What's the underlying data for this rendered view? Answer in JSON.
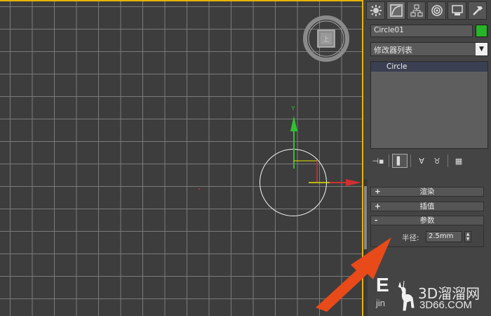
{
  "viewport": {
    "gizmo": {
      "y_axis_label": "Y"
    }
  },
  "panel": {
    "tabs": [
      {
        "icon": "sun-gear-icon",
        "active": false
      },
      {
        "icon": "create-shapes-icon",
        "active": true
      },
      {
        "icon": "hierarchy-icon",
        "active": false
      },
      {
        "icon": "motion-icon",
        "active": false
      },
      {
        "icon": "display-icon",
        "active": false
      },
      {
        "icon": "utilities-hammer-icon",
        "active": false
      }
    ],
    "object_name": "Circle01",
    "object_color": "#28b428",
    "modifier_list": "修改器列表",
    "stack": [
      "Circle"
    ],
    "rollouts": [
      {
        "sign": "+",
        "title": "渲染"
      },
      {
        "sign": "+",
        "title": "插值"
      },
      {
        "sign": "-",
        "title": "参数"
      }
    ],
    "parameters": {
      "radius_label": "半径:",
      "radius_value": "2.5mm"
    }
  },
  "watermark": {
    "logo_letters": "E",
    "logo_sub": "jin",
    "brand": "3D溜溜网",
    "url": "3D66.COM"
  },
  "colors": {
    "accent_border": "#e8b400",
    "arrow": "#e84a1a",
    "stack_highlight": "#3a3f52"
  }
}
